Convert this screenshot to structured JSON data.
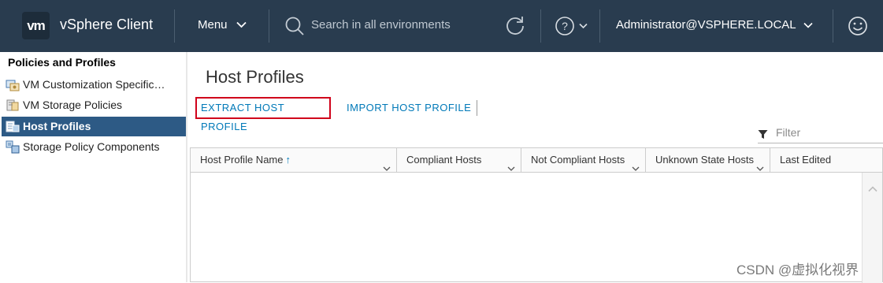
{
  "header": {
    "logo": "vm",
    "app_title": "vSphere Client",
    "menu_label": "Menu",
    "search_placeholder": "Search in all environments",
    "user": "Administrator@VSPHERE.LOCAL",
    "icons": [
      "search-icon",
      "refresh-icon",
      "help-icon",
      "smiley-icon"
    ],
    "bg_color": "#293c4f"
  },
  "sidebar": {
    "title": "Policies and Profiles",
    "items": [
      {
        "label": "VM Customization Specific…",
        "icon": "vm-customization-icon",
        "selected": false
      },
      {
        "label": "VM Storage Policies",
        "icon": "storage-policy-icon",
        "selected": false
      },
      {
        "label": "Host Profiles",
        "icon": "host-profile-icon",
        "selected": true
      },
      {
        "label": "Storage Policy Components",
        "icon": "policy-components-icon",
        "selected": false
      }
    ],
    "selected_color": "#2d5a85"
  },
  "main": {
    "title": "Host Profiles",
    "actions": {
      "extract": "EXTRACT HOST PROFILE",
      "import": "IMPORT HOST PROFILE"
    },
    "filter_placeholder": "Filter",
    "columns": [
      {
        "label": "Host Profile Name",
        "sorted": "ascending"
      },
      {
        "label": "Compliant Hosts"
      },
      {
        "label": "Not Compliant Hosts"
      },
      {
        "label": "Unknown State Hosts"
      },
      {
        "label": "Last Edited"
      }
    ],
    "rows": [],
    "link_color": "#0079b8",
    "highlight_color": "#d0021b"
  },
  "watermark": "CSDN @虚拟化视界"
}
